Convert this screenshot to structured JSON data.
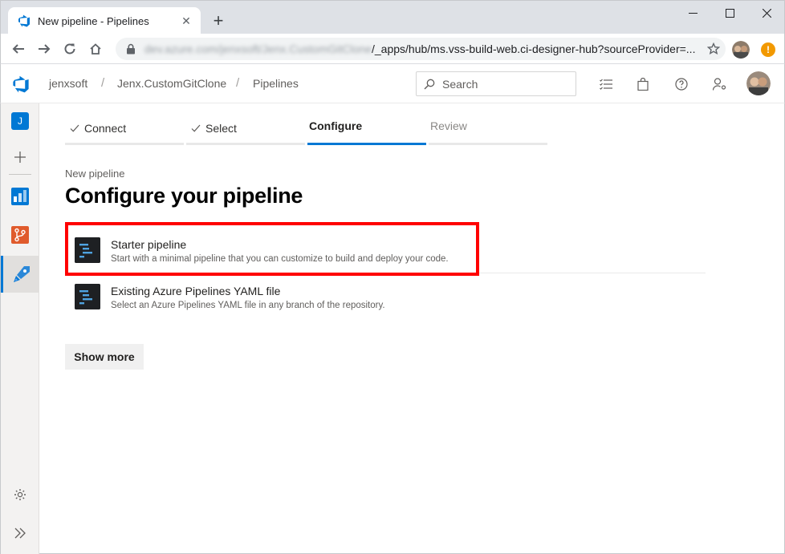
{
  "browser": {
    "tab_title": "New pipeline - Pipelines",
    "tab_close": "✕",
    "new_tab": "+",
    "url_host_blurred": "dev.azure.com/jenxsoft/Jenx.CustomGitClone",
    "url_path": "/_apps/hub/ms.vss-build-web.ci-designer-hub?sourceProvider=...",
    "notification_badge": "!"
  },
  "header": {
    "breadcrumbs": [
      "jenxsoft",
      "Jenx.CustomGitClone",
      "Pipelines"
    ],
    "separator": "/",
    "search_placeholder": "Search"
  },
  "nav": {
    "project_initial": "J"
  },
  "wizard": {
    "steps": [
      {
        "label": "Connect",
        "state": "done"
      },
      {
        "label": "Select",
        "state": "done"
      },
      {
        "label": "Configure",
        "state": "current"
      },
      {
        "label": "Review",
        "state": "todo"
      }
    ]
  },
  "page": {
    "subtitle": "New pipeline",
    "title": "Configure your pipeline"
  },
  "options": [
    {
      "title": "Starter pipeline",
      "description": "Start with a minimal pipeline that you can customize to build and deploy your code."
    },
    {
      "title": "Existing Azure Pipelines YAML file",
      "description": "Select an Azure Pipelines YAML file in any branch of the repository."
    }
  ],
  "show_more_label": "Show more",
  "colors": {
    "accent": "#0078d4",
    "highlight": "#ff0000",
    "tile_dark": "#1e2023"
  }
}
